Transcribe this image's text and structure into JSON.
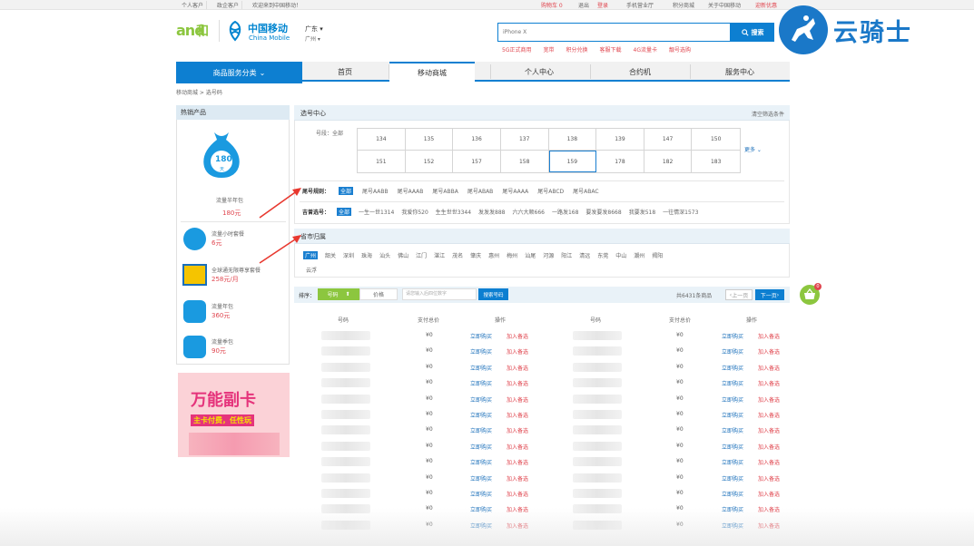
{
  "topbar": {
    "left": [
      "个人客户",
      "政企客户",
      "欢迎来到中国移动！"
    ],
    "right": [
      "购物车 0",
      "退出",
      "登录",
      "手机营业厅",
      "积分商城",
      "关于中国移动",
      "迎新优惠"
    ]
  },
  "logo": {
    "and": "and",
    "he": "和",
    "cm_cn": "中国移动",
    "cm_en": "China Mobile"
  },
  "location": {
    "province": "广东",
    "city": "广州"
  },
  "search": {
    "placeholder": "iPhone X",
    "button": "搜索"
  },
  "hot_links": [
    "5G正式商用",
    "宽带",
    "积分兑换",
    "客服下载",
    "4G流量卡",
    "靓号选购"
  ],
  "watermark": {
    "text": "云骑士"
  },
  "nav": {
    "category": "商品服务分类",
    "items": [
      "首页",
      "移动商城",
      "个人中心",
      "合约机",
      "服务中心"
    ]
  },
  "breadcrumb": "移动商城  >  选号码",
  "sidebar": {
    "title": "热销产品",
    "featured": {
      "bag_number": "180",
      "bag_unit": "天",
      "name": "流量半年包",
      "price": "180元"
    },
    "items": [
      {
        "name": "流量小时套餐",
        "price": "6元"
      },
      {
        "name": "全球通无限尊享套餐",
        "price": "258元/月"
      },
      {
        "name": "流量年包",
        "price": "360元"
      },
      {
        "name": "流量季包",
        "price": "90元"
      }
    ],
    "banner": {
      "title": "万能副卡",
      "sub": "主卡付费，任性玩"
    }
  },
  "number_center": {
    "title": "选号中心",
    "link": "清空筛选条件",
    "segment_label": "号段：全部",
    "segments": [
      "134",
      "135",
      "136",
      "137",
      "138",
      "139",
      "147",
      "150",
      "151",
      "152",
      "157",
      "158",
      "159",
      "178",
      "182",
      "183"
    ],
    "selected": "159",
    "more": "更多",
    "tail_label": "尾号规则：",
    "tail_all": "全部",
    "tail_rules": [
      "尾号AABB",
      "尾号AAAB",
      "尾号ABBA",
      "尾号ABAB",
      "尾号AAAA",
      "尾号ABCD",
      "尾号ABAC"
    ],
    "lucky_label": "吉曾选号：",
    "lucky_all": "全部",
    "lucky_rules": [
      "一生一世1314",
      "我爱你520",
      "生生世世3344",
      "发发发888",
      "六六大顺666",
      "一路发168",
      "要发要发8668",
      "我要发518",
      "一往情深1573"
    ]
  },
  "region": {
    "title": "省市归属",
    "cities": [
      "广州",
      "韶关",
      "深圳",
      "珠海",
      "汕头",
      "佛山",
      "江门",
      "湛江",
      "茂名",
      "肇庆",
      "惠州",
      "梅州",
      "汕尾",
      "河源",
      "阳江",
      "清远",
      "东莞",
      "中山",
      "潮州",
      "揭阳",
      "云浮"
    ]
  },
  "sort": {
    "label": "排序：",
    "by_number": "号码",
    "by_price": "价格",
    "input_placeholder": "请您输入后四位数字",
    "search_btn": "搜索号码",
    "total": "共6431条商品",
    "prev": "上一页",
    "next": "下一页"
  },
  "table": {
    "headers": [
      "号码",
      "支付总价",
      "操作",
      "号码",
      "支付总价",
      "操作"
    ],
    "price": "¥0",
    "buy": "立即购买",
    "add": "加入备选",
    "row_count": 13
  },
  "cart": {
    "count": "0"
  }
}
